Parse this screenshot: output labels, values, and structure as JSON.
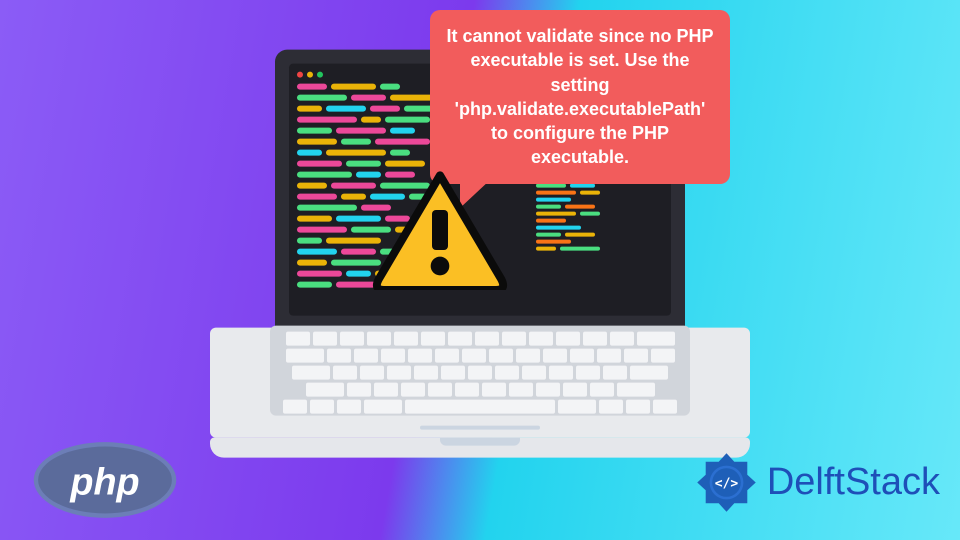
{
  "bubble_text": "It cannot validate since no PHP executable is set. Use the setting 'php.validate.executablePath' to configure the PHP executable.",
  "php_label": "php",
  "brand": "DelftStack",
  "colors": {
    "bubble": "#f25c5c",
    "warning_fill": "#fbbf24",
    "warning_stroke": "#0b0b0b",
    "php_bg": "#4f5b93",
    "brand_text": "#1e4fb8"
  }
}
